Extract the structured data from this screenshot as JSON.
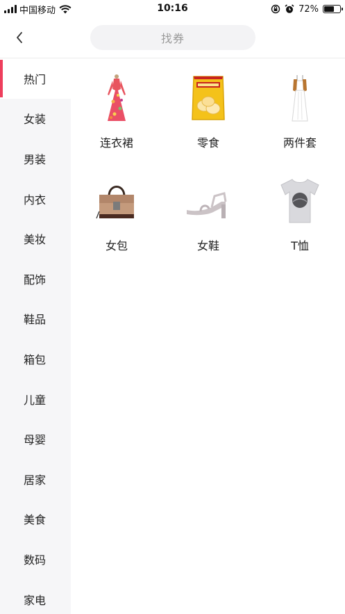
{
  "status_bar": {
    "carrier": "中国移动",
    "time": "10:16",
    "battery_percent": "72%",
    "battery_level": 0.72,
    "icons": [
      "signal-icon",
      "wifi-icon",
      "rotation-lock-icon",
      "alarm-icon",
      "battery-icon"
    ]
  },
  "nav": {
    "back_icon": "chevron-left-icon",
    "search_label": "找券"
  },
  "colors": {
    "accent": "#ee3e5c",
    "sidebar_bg": "#f6f6f8",
    "search_bg": "#f3f3f5"
  },
  "sidebar": {
    "active_index": 0,
    "items": [
      {
        "label": "热门"
      },
      {
        "label": "女装"
      },
      {
        "label": "男装"
      },
      {
        "label": "内衣"
      },
      {
        "label": "美妆"
      },
      {
        "label": "配饰"
      },
      {
        "label": "鞋品"
      },
      {
        "label": "箱包"
      },
      {
        "label": "儿童"
      },
      {
        "label": "母婴"
      },
      {
        "label": "居家"
      },
      {
        "label": "美食"
      },
      {
        "label": "数码"
      },
      {
        "label": "家电"
      }
    ]
  },
  "categories": [
    {
      "label": "连衣裙",
      "icon": "dress-image"
    },
    {
      "label": "零食",
      "icon": "snack-bag-image"
    },
    {
      "label": "两件套",
      "icon": "two-piece-image"
    },
    {
      "label": "女包",
      "icon": "handbag-image"
    },
    {
      "label": "女鞋",
      "icon": "sandal-image"
    },
    {
      "label": "T恤",
      "icon": "tshirt-image"
    }
  ]
}
